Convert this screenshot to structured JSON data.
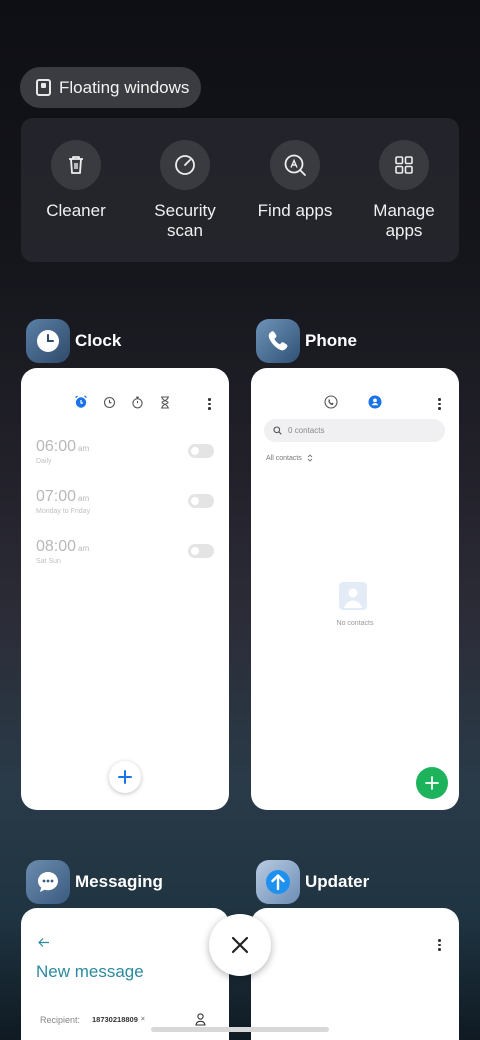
{
  "floating_windows": {
    "label": "Floating windows"
  },
  "tools": [
    {
      "label": "Cleaner",
      "icon": "trash-icon"
    },
    {
      "label": "Security\nscan",
      "icon": "security-scan-icon"
    },
    {
      "label": "Find apps",
      "icon": "find-apps-icon"
    },
    {
      "label": "Manage\napps",
      "icon": "grid-icon"
    }
  ],
  "apps": {
    "clock": {
      "title": "Clock",
      "alarms": [
        {
          "time": "06:00",
          "ampm": "am",
          "repeat": "Daily"
        },
        {
          "time": "07:00",
          "ampm": "am",
          "repeat": "Monday to Friday"
        },
        {
          "time": "08:00",
          "ampm": "am",
          "repeat": "Sat Sun"
        }
      ]
    },
    "phone": {
      "title": "Phone",
      "search_placeholder": "0 contacts",
      "filter_label": "All contacts",
      "empty_text": "No contacts"
    },
    "messaging": {
      "title": "Messaging",
      "heading": "New message",
      "recipient_label": "Recipient:",
      "recipient_chip": "18730218809"
    },
    "updater": {
      "title": "Updater"
    }
  },
  "colors": {
    "clock_accent": "#1a73e8",
    "phone_accent": "#1a73e8",
    "phone_fab": "#1db35c",
    "messaging_accent": "#2b8a9e"
  }
}
